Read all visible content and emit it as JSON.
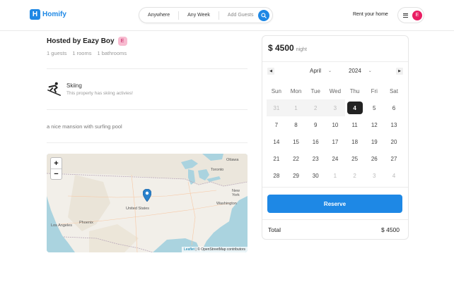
{
  "header": {
    "logo_letter": "H",
    "logo_text": "Homify",
    "search": {
      "location": "Anywhere",
      "week": "Any Week",
      "guests": "Add Guests"
    },
    "rent_label": "Rent your home",
    "avatar_letter": "E"
  },
  "listing": {
    "hosted_by": "Hosted by Eazy Boy",
    "host_avatar_letter": "E",
    "guests": "1 guests",
    "rooms": "1 rooms",
    "bathrooms": "1 bathrooms",
    "feature": {
      "icon": "skiing-icon",
      "title": "Skiing",
      "description": "This property has skiing activies!"
    },
    "description": "a nice mansion with surfing pool"
  },
  "map": {
    "zoom_in": "+",
    "zoom_out": "−",
    "labels": {
      "ottawa": "Ottawa",
      "toronto": "Toronto",
      "new_york": "New York",
      "washington": "Washington",
      "united_states": "United States",
      "los_angeles": "Los Angeles",
      "phoenix": "Phoenix"
    },
    "attribution_leaflet": "Leaflet",
    "attribution_rest": " | © OpenStreetMap contributors"
  },
  "booking": {
    "price": "$ 4500",
    "per": "night",
    "month": "April",
    "year": "2024",
    "prev": "◀",
    "next": "▶",
    "weekdays": [
      "Sun",
      "Mon",
      "Tue",
      "Wed",
      "Thu",
      "Fri",
      "Sat"
    ],
    "weeks": [
      [
        "31",
        "1",
        "2",
        "3",
        "4",
        "5",
        "6"
      ],
      [
        "7",
        "8",
        "9",
        "10",
        "11",
        "12",
        "13"
      ],
      [
        "14",
        "15",
        "16",
        "17",
        "18",
        "19",
        "20"
      ],
      [
        "21",
        "22",
        "23",
        "24",
        "25",
        "26",
        "27"
      ],
      [
        "28",
        "29",
        "30",
        "1",
        "2",
        "3",
        "4"
      ]
    ],
    "selected_day": "4",
    "reserve_label": "Reserve",
    "total_label": "Total",
    "total_value": "$ 4500"
  },
  "colors": {
    "accent": "#1e88e5",
    "avatar": "#e91e63"
  }
}
